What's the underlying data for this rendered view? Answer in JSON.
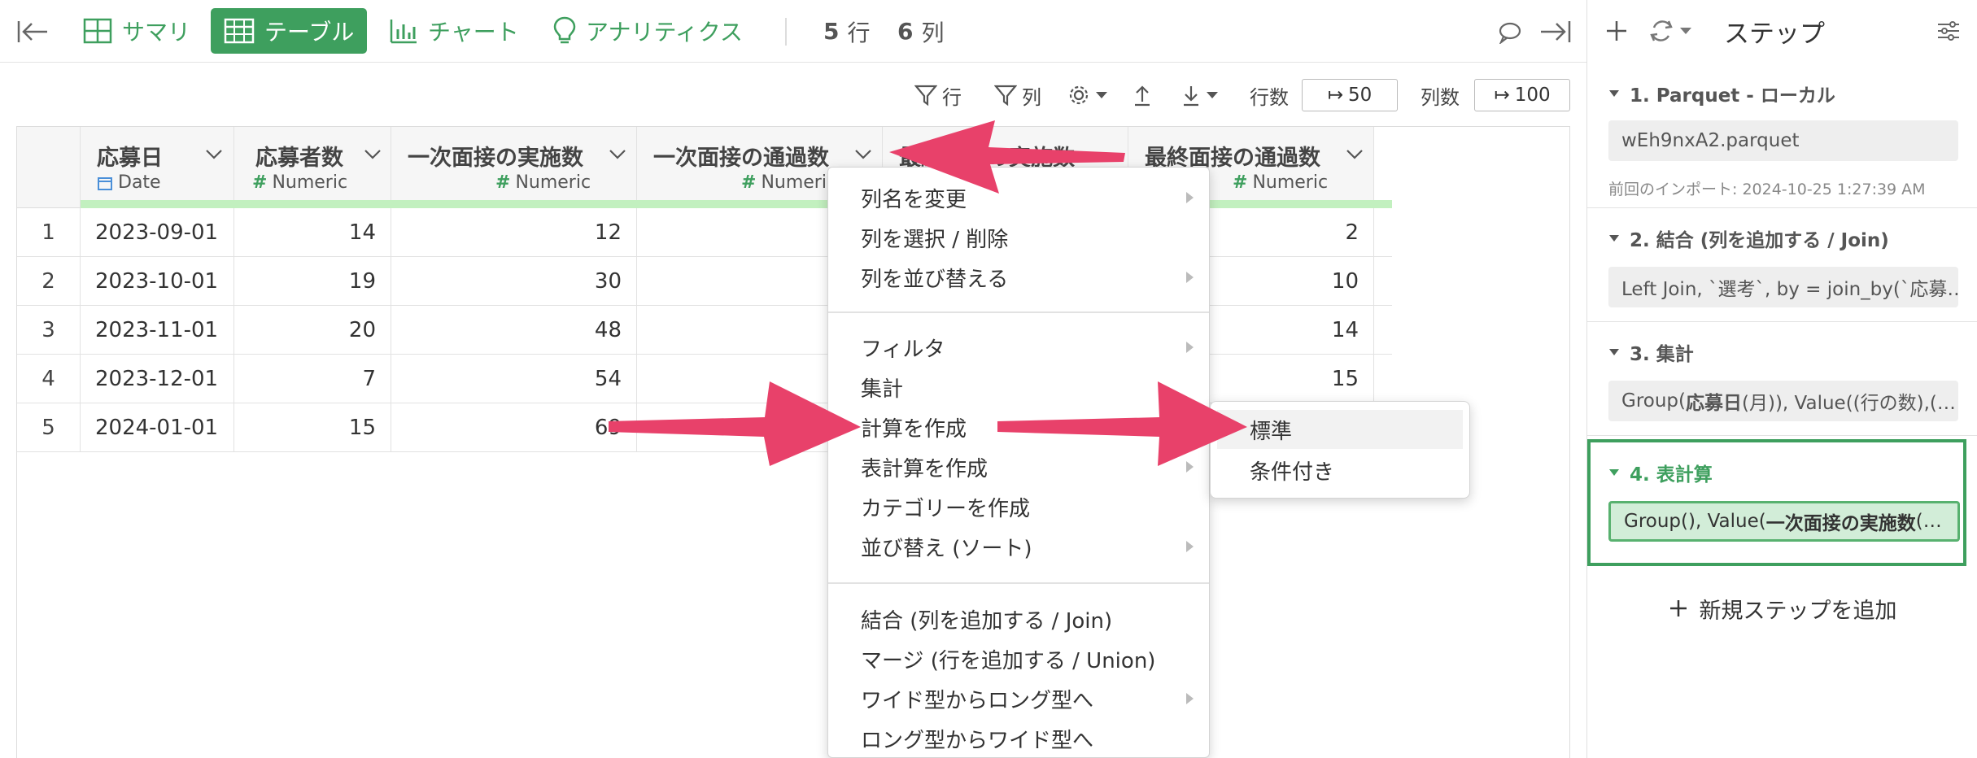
{
  "toolbar": {
    "tabs": [
      {
        "label": "サマリ"
      },
      {
        "label": "テーブル"
      },
      {
        "label": "チャート"
      },
      {
        "label": "アナリティクス"
      }
    ],
    "rows_count": "5",
    "rows_unit": "行",
    "cols_count": "6",
    "cols_unit": "列"
  },
  "table_tools": {
    "row_filter": "行",
    "col_filter": "列",
    "rows_label": "行数",
    "rows_value": "50",
    "cols_label": "列数",
    "cols_value": "100"
  },
  "columns": [
    {
      "name": "応募日",
      "type": "Date"
    },
    {
      "name": "応募者数",
      "type": "Numeric"
    },
    {
      "name": "一次面接の実施数",
      "type": "Numeric"
    },
    {
      "name": "一次面接の通過数",
      "type": "Numeric"
    },
    {
      "name": "最終面接の実施数",
      "type": "Numeric"
    },
    {
      "name": "最終面接の通過数",
      "type": "Numeric"
    }
  ],
  "rows": [
    {
      "idx": "1",
      "date": "2023-09-01",
      "applicants": "14",
      "first_held": "12",
      "final_passed": "2"
    },
    {
      "idx": "2",
      "date": "2023-10-01",
      "applicants": "19",
      "first_held": "30",
      "final_passed": "10"
    },
    {
      "idx": "3",
      "date": "2023-11-01",
      "applicants": "20",
      "first_held": "48",
      "final_passed": "14"
    },
    {
      "idx": "4",
      "date": "2023-12-01",
      "applicants": "7",
      "first_held": "54",
      "final_passed": "15"
    },
    {
      "idx": "5",
      "date": "2024-01-01",
      "applicants": "15",
      "first_held": "69",
      "final_passed": ""
    }
  ],
  "context_menu": {
    "items": [
      {
        "label": "列名を変更"
      },
      {
        "label": "列を選択 / 削除"
      },
      {
        "label": "列を並び替える"
      },
      {
        "label": "フィルタ"
      },
      {
        "label": "集計"
      },
      {
        "label": "計算を作成"
      },
      {
        "label": "表計算を作成"
      },
      {
        "label": "カテゴリーを作成"
      },
      {
        "label": "並び替え (ソート)"
      },
      {
        "label": "結合 (列を追加する / Join)"
      },
      {
        "label": "マージ (行を追加する / Union)"
      },
      {
        "label": "ワイド型からロング型へ"
      },
      {
        "label": "ロング型からワイド型へ"
      }
    ],
    "submenu": [
      {
        "label": "標準"
      },
      {
        "label": "条件付き"
      }
    ]
  },
  "steps_panel": {
    "title": "ステップ",
    "steps": [
      {
        "title": "1. Parquet - ローカル",
        "detail": "wEh9nxA2.parquet",
        "note": "前回のインポート: 2024-10-25 1:27:39 AM"
      },
      {
        "title": "2. 結合 (列を追加する / Join)",
        "detail": "Left Join, `選考`, by = join_by(`応募…"
      },
      {
        "title": "3. 集計",
        "detail_pre": "Group(",
        "detail_bold": "応募日",
        "detail_post": " (月)), Value((行の数),(…"
      },
      {
        "title": "4. 表計算",
        "detail_pre": "Group(), Value(",
        "detail_bold": "一次面接の実施数",
        "detail_post": " (…"
      }
    ],
    "add_step": "新規ステップを追加"
  },
  "colors": {
    "accent": "#3e9f5e",
    "arrow": "#e8416a",
    "header_strip": "#c2f0bf"
  }
}
